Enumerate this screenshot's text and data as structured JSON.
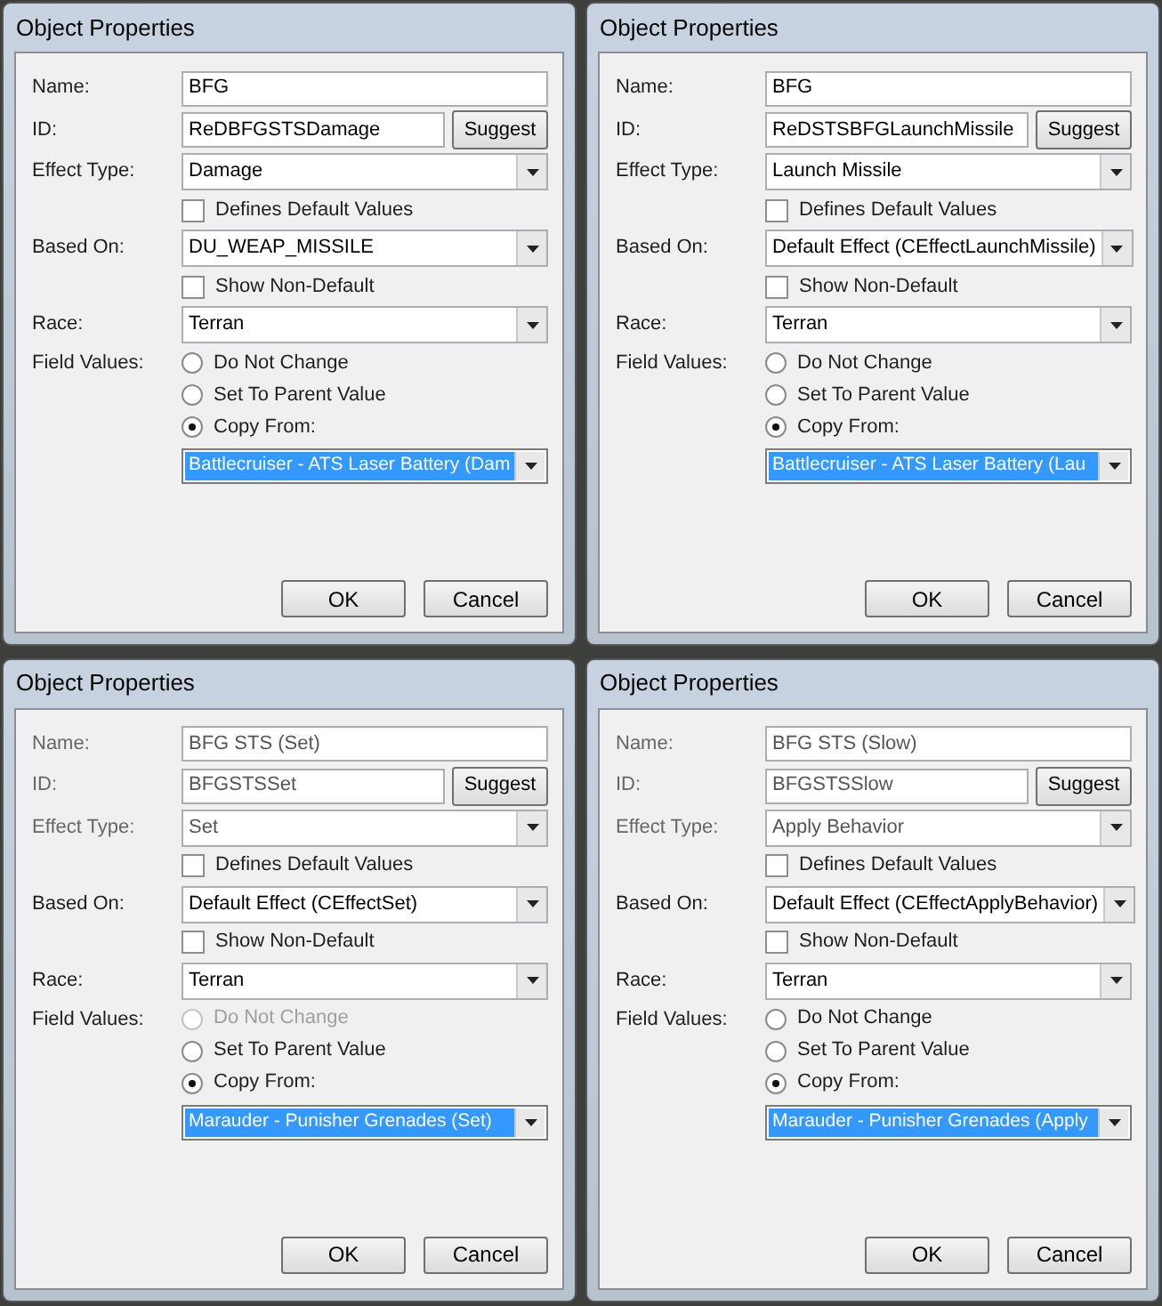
{
  "dialogs": [
    {
      "title": "Object Properties",
      "rows": [
        {
          "kind": "text",
          "label": "Name:",
          "value": "BFG",
          "disabled": false
        },
        {
          "kind": "text_button",
          "label": "ID:",
          "value": "ReDBFGSTSDamage",
          "button": "Suggest",
          "disabled": false
        },
        {
          "kind": "dropdown",
          "label": "Effect Type:",
          "value": "Damage",
          "disabled": false
        },
        {
          "kind": "checkbox",
          "label": "Defines Default Values",
          "checked": false
        },
        {
          "kind": "dropdown",
          "label": "Based On:",
          "value": "DU_WEAP_MISSILE",
          "disabled": false
        },
        {
          "kind": "checkbox",
          "label": "Show Non-Default",
          "checked": false
        },
        {
          "kind": "dropdown",
          "label": "Race:",
          "value": "Terran",
          "disabled": false
        }
      ],
      "field_values": {
        "label": "Field Values:",
        "options": [
          {
            "label": "Do Not Change",
            "selected": false,
            "disabled": false
          },
          {
            "label": "Set To Parent Value",
            "selected": false,
            "disabled": false
          },
          {
            "label": "Copy From:",
            "selected": true,
            "disabled": false
          }
        ],
        "copy_from": "Battlecruiser - ATS Laser Battery (Dam"
      },
      "buttons": [
        "OK",
        "Cancel"
      ]
    },
    {
      "title": "Object Properties",
      "rows": [
        {
          "kind": "text",
          "label": "Name:",
          "value": "BFG",
          "disabled": false
        },
        {
          "kind": "text_button",
          "label": "ID:",
          "value": "ReDSTSBFGLaunchMissile",
          "button": "Suggest",
          "disabled": false
        },
        {
          "kind": "dropdown",
          "label": "Effect Type:",
          "value": "Launch Missile",
          "disabled": false
        },
        {
          "kind": "checkbox",
          "label": "Defines Default Values",
          "checked": false
        },
        {
          "kind": "dropdown",
          "label": "Based On:",
          "value": "Default Effect (CEffectLaunchMissile)",
          "disabled": false
        },
        {
          "kind": "checkbox",
          "label": "Show Non-Default",
          "checked": false
        },
        {
          "kind": "dropdown",
          "label": "Race:",
          "value": "Terran",
          "disabled": false
        }
      ],
      "field_values": {
        "label": "Field Values:",
        "options": [
          {
            "label": "Do Not Change",
            "selected": false,
            "disabled": false
          },
          {
            "label": "Set To Parent Value",
            "selected": false,
            "disabled": false
          },
          {
            "label": "Copy From:",
            "selected": true,
            "disabled": false
          }
        ],
        "copy_from": "Battlecruiser - ATS Laser Battery (Lau"
      },
      "buttons": [
        "OK",
        "Cancel"
      ]
    },
    {
      "title": "Object Properties",
      "rows": [
        {
          "kind": "text",
          "label": "Name:",
          "value": "BFG STS (Set)",
          "disabled": true
        },
        {
          "kind": "text_button",
          "label": "ID:",
          "value": "BFGSTSSet",
          "button": "Suggest",
          "disabled": true
        },
        {
          "kind": "dropdown",
          "label": "Effect Type:",
          "value": "Set",
          "disabled": true
        },
        {
          "kind": "checkbox",
          "label": "Defines Default Values",
          "checked": false
        },
        {
          "kind": "dropdown",
          "label": "Based On:",
          "value": "Default Effect (CEffectSet)",
          "disabled": false
        },
        {
          "kind": "checkbox",
          "label": "Show Non-Default",
          "checked": false
        },
        {
          "kind": "dropdown",
          "label": "Race:",
          "value": "Terran",
          "disabled": false
        }
      ],
      "field_values": {
        "label": "Field Values:",
        "options": [
          {
            "label": "Do Not Change",
            "selected": false,
            "disabled": true
          },
          {
            "label": "Set To Parent Value",
            "selected": false,
            "disabled": false
          },
          {
            "label": "Copy From:",
            "selected": true,
            "disabled": false
          }
        ],
        "copy_from": "Marauder - Punisher Grenades (Set)"
      },
      "buttons": [
        "OK",
        "Cancel"
      ]
    },
    {
      "title": "Object Properties",
      "rows": [
        {
          "kind": "text",
          "label": "Name:",
          "value": "BFG STS (Slow)",
          "disabled": true
        },
        {
          "kind": "text_button",
          "label": "ID:",
          "value": "BFGSTSSlow",
          "button": "Suggest",
          "disabled": true
        },
        {
          "kind": "dropdown",
          "label": "Effect Type:",
          "value": "Apply Behavior",
          "disabled": true
        },
        {
          "kind": "checkbox",
          "label": "Defines Default Values",
          "checked": false
        },
        {
          "kind": "dropdown",
          "label": "Based On:",
          "value": "Default Effect (CEffectApplyBehavior)",
          "disabled": false
        },
        {
          "kind": "checkbox",
          "label": "Show Non-Default",
          "checked": false
        },
        {
          "kind": "dropdown",
          "label": "Race:",
          "value": "Terran",
          "disabled": false
        }
      ],
      "field_values": {
        "label": "Field Values:",
        "options": [
          {
            "label": "Do Not Change",
            "selected": false,
            "disabled": false
          },
          {
            "label": "Set To Parent Value",
            "selected": false,
            "disabled": false
          },
          {
            "label": "Copy From:",
            "selected": true,
            "disabled": false
          }
        ],
        "copy_from": "Marauder - Punisher Grenades (Apply"
      },
      "buttons": [
        "OK",
        "Cancel"
      ]
    }
  ]
}
